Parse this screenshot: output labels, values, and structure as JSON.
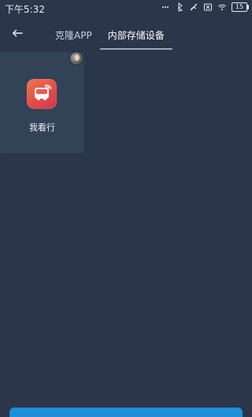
{
  "status_bar": {
    "time": "下午5:32",
    "battery_text": "15",
    "icons": [
      "signal-icon",
      "bluetooth-icon",
      "no-signal-icon",
      "close-box-icon",
      "wifi-icon",
      "battery-icon"
    ]
  },
  "header": {
    "back_icon": "back-arrow-icon",
    "tabs": [
      {
        "label": "克隆APP"
      },
      {
        "label": "内部存储设备"
      }
    ],
    "active_tab_index": 1
  },
  "content": {
    "apps": [
      {
        "name": "我看行",
        "icon": "bus-app-icon"
      }
    ]
  },
  "colors": {
    "background": "#2b364a",
    "tile": "#324257",
    "accent": "#1f8fd9",
    "app_gradient_start": "#ef7a4b",
    "app_gradient_end": "#c93a50"
  }
}
